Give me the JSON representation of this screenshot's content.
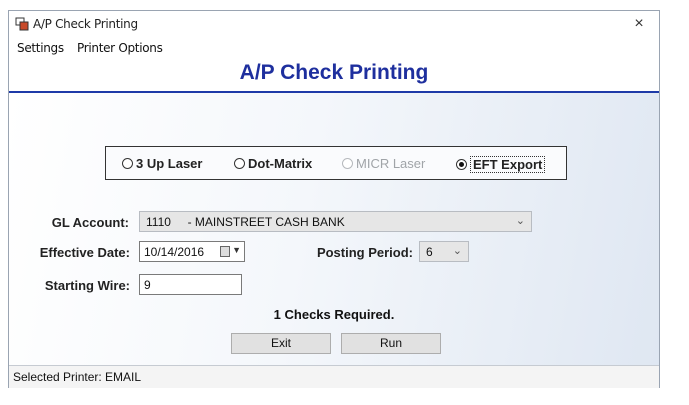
{
  "window": {
    "title": "A/P Check Printing",
    "close_glyph": "×"
  },
  "menu": {
    "items": [
      "Settings",
      "Printer Options"
    ]
  },
  "header": {
    "title": "A/P Check Printing"
  },
  "print_type": {
    "options": [
      {
        "label": "3 Up Laser",
        "checked": false,
        "enabled": true
      },
      {
        "label": "Dot-Matrix",
        "checked": false,
        "enabled": true
      },
      {
        "label": "MICR Laser",
        "checked": false,
        "enabled": false
      },
      {
        "label": "EFT Export",
        "checked": true,
        "enabled": true
      }
    ]
  },
  "form": {
    "gl_account_label": "GL Account:",
    "gl_account_value": "1110     - MAINSTREET CASH BANK",
    "effective_date_label": "Effective Date:",
    "effective_date_value": "10/14/2016",
    "posting_period_label": "Posting Period:",
    "posting_period_value": "6",
    "starting_wire_label": "Starting Wire:",
    "starting_wire_value": "9"
  },
  "checks_required": "1 Checks Required.",
  "buttons": {
    "exit": "Exit",
    "run": "Run"
  },
  "status": {
    "text": "Selected Printer:  EMAIL"
  },
  "colors": {
    "accent": "#1e2f9e",
    "header_rule": "#1e3aa8"
  }
}
